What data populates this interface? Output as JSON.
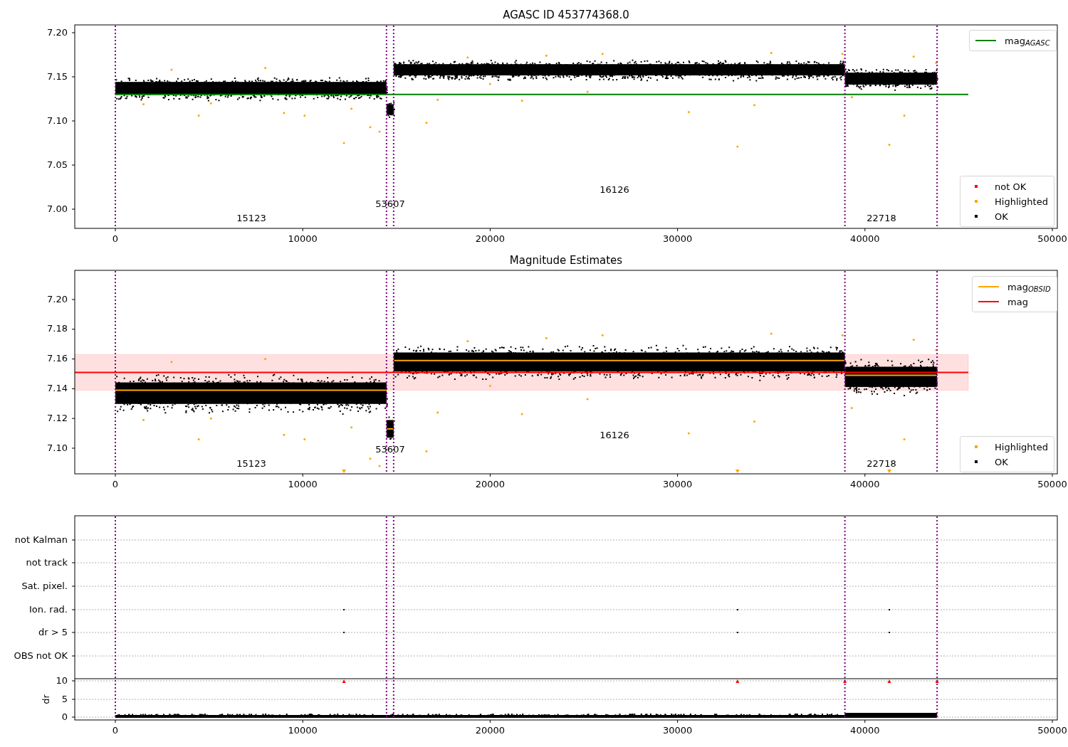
{
  "panels": [
    {
      "title": "AGASC ID 453774368.0",
      "yticks": [
        "7.20",
        "7.15",
        "7.10",
        "7.05",
        "7.00"
      ],
      "xticks": [
        "0",
        "10000",
        "20000",
        "30000",
        "40000",
        "50000"
      ],
      "segment_labels": [
        "15123",
        "53607",
        "16126",
        "22718"
      ],
      "legends": [
        [
          {
            "kind": "line",
            "color": "#008000",
            "label": "mag$_{AGASC}$"
          }
        ],
        [
          {
            "kind": "dot",
            "color": "#ff0000",
            "label": "not OK"
          },
          {
            "kind": "dot",
            "color": "#ffa500",
            "label": "Highlighted"
          },
          {
            "kind": "dot",
            "color": "#000000",
            "label": "OK"
          }
        ]
      ]
    },
    {
      "title": "Magnitude Estimates",
      "yticks": [
        "7.20",
        "7.18",
        "7.16",
        "7.14",
        "7.12",
        "7.10"
      ],
      "xticks": [
        "0",
        "10000",
        "20000",
        "30000",
        "40000",
        "50000"
      ],
      "segment_labels": [
        "15123",
        "53607",
        "16126",
        "22718"
      ],
      "legends": [
        [
          {
            "kind": "line",
            "color": "#ffa500",
            "label": "mag$_{OBSID}$"
          },
          {
            "kind": "line",
            "color": "#ff0000",
            "label": "mag"
          }
        ],
        [
          {
            "kind": "dot",
            "color": "#ffa500",
            "label": "Highlighted"
          },
          {
            "kind": "dot",
            "color": "#000000",
            "label": "OK"
          }
        ]
      ]
    },
    {
      "categories": [
        "not Kalman",
        "not track",
        "Sat. pixel.",
        "Ion. rad.",
        "dr > 5",
        "OBS not OK"
      ],
      "ylabel": "dr",
      "yticks": [
        "10",
        "5",
        "0"
      ],
      "xticks": [
        "0",
        "10000",
        "20000",
        "30000",
        "40000",
        "50000"
      ]
    }
  ]
}
